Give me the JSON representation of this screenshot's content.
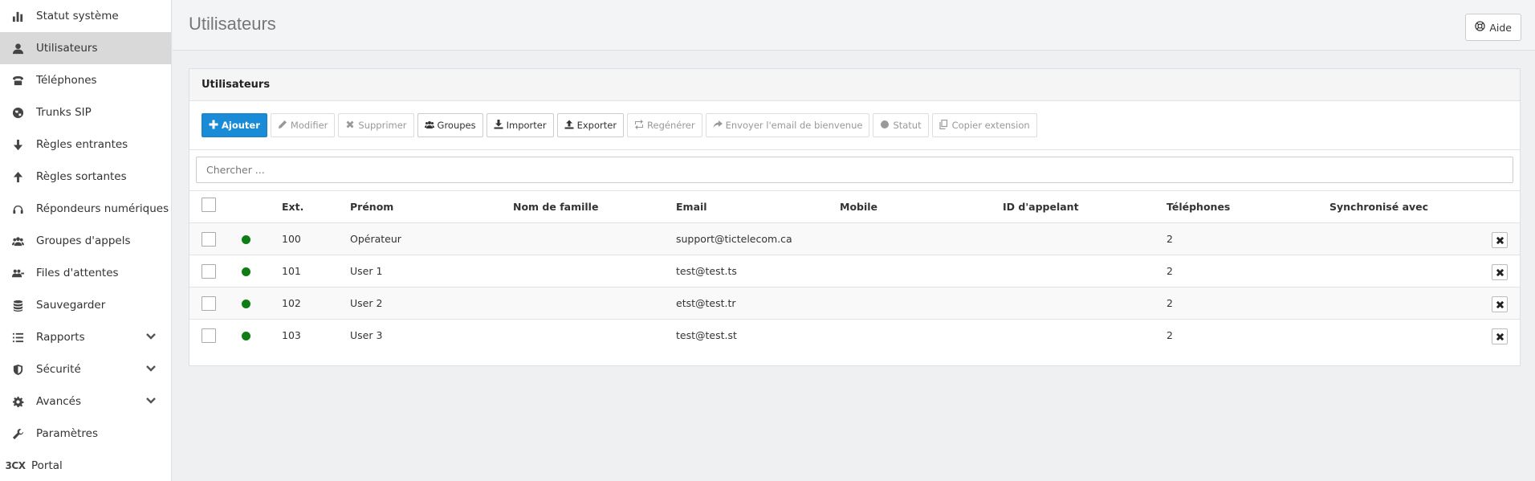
{
  "sidebar": {
    "items": [
      {
        "label": "Statut système",
        "icon": "bar-chart-icon"
      },
      {
        "label": "Utilisateurs",
        "icon": "user-icon",
        "active": true
      },
      {
        "label": "Téléphones",
        "icon": "phone-icon"
      },
      {
        "label": "Trunks SIP",
        "icon": "globe-icon"
      },
      {
        "label": "Règles entrantes",
        "icon": "arrow-down-icon"
      },
      {
        "label": "Règles sortantes",
        "icon": "arrow-up-icon"
      },
      {
        "label": "Répondeurs numériques",
        "icon": "headset-icon"
      },
      {
        "label": "Groupes d'appels",
        "icon": "users-icon"
      },
      {
        "label": "Files d'attentes",
        "icon": "queue-icon"
      },
      {
        "label": "Sauvegarder",
        "icon": "database-icon"
      },
      {
        "label": "Rapports",
        "icon": "list-icon",
        "expandable": true
      },
      {
        "label": "Sécurité",
        "icon": "shield-icon",
        "expandable": true
      },
      {
        "label": "Avancés",
        "icon": "gear-icon",
        "expandable": true
      },
      {
        "label": "Paramètres",
        "icon": "wrench-icon"
      },
      {
        "label": "Portal",
        "icon": "3cx-logo",
        "icon_text": "3CX"
      }
    ]
  },
  "header": {
    "title": "Utilisateurs",
    "help_label": "Aide"
  },
  "panel": {
    "title": "Utilisateurs",
    "toolbar": {
      "add": "Ajouter",
      "edit": "Modifier",
      "delete": "Supprimer",
      "groups": "Groupes",
      "import": "Importer",
      "export": "Exporter",
      "regenerate": "Regénérer",
      "send_welcome": "Envoyer l'email de bienvenue",
      "status": "Statut",
      "copy_extension": "Copier extension"
    },
    "search_placeholder": "Chercher ...",
    "columns": {
      "ext": "Ext.",
      "first": "Prénom",
      "last": "Nom de famille",
      "email": "Email",
      "mobile": "Mobile",
      "caller_id": "ID d'appelant",
      "phones": "Téléphones",
      "sync": "Synchronisé avec"
    },
    "rows": [
      {
        "ext": "100",
        "first": "Opérateur",
        "last": "",
        "email": "support@tictelecom.ca",
        "mobile": "",
        "caller_id": "",
        "phones": "2",
        "sync": "",
        "status_color": "#0d7d14"
      },
      {
        "ext": "101",
        "first": "User 1",
        "last": "",
        "email": "test@test.ts",
        "mobile": "",
        "caller_id": "",
        "phones": "2",
        "sync": "",
        "status_color": "#0d7d14"
      },
      {
        "ext": "102",
        "first": "User 2",
        "last": "",
        "email": "etst@test.tr",
        "mobile": "",
        "caller_id": "",
        "phones": "2",
        "sync": "",
        "status_color": "#0d7d14"
      },
      {
        "ext": "103",
        "first": "User 3",
        "last": "",
        "email": "test@test.st",
        "mobile": "",
        "caller_id": "",
        "phones": "2",
        "sync": "",
        "status_color": "#0d7d14"
      }
    ]
  },
  "colors": {
    "primary": "#1a8bd6",
    "active_nav": "#d9d9d9",
    "status_online": "#0d7d14"
  }
}
